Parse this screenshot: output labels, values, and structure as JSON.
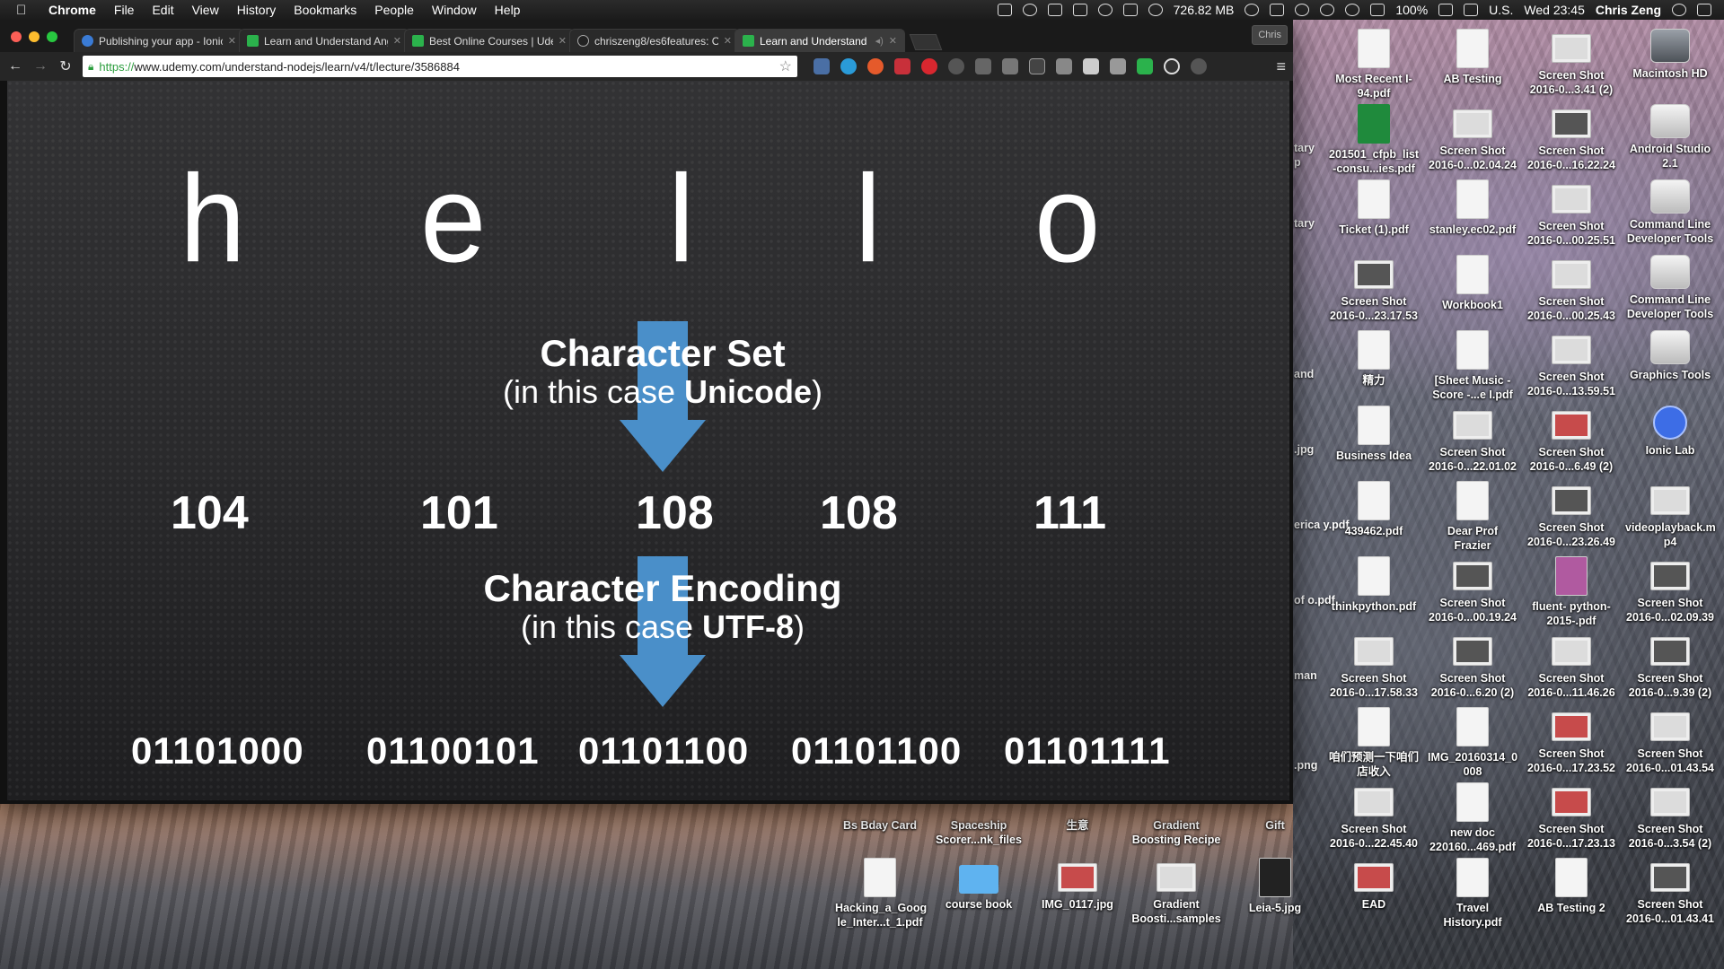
{
  "menubar": {
    "app": "Chrome",
    "menus": [
      "File",
      "Edit",
      "View",
      "History",
      "Bookmarks",
      "People",
      "Window",
      "Help"
    ],
    "memory": "726.82 MB",
    "battery": "100%",
    "input_source": "U.S.",
    "clock": "Wed 23:45",
    "user": "Chris Zeng"
  },
  "browser": {
    "profile": "Chris",
    "tabs": [
      {
        "title": "Publishing your app - Ionic",
        "favicon": "ionic",
        "active": false
      },
      {
        "title": "Learn and Understand Angular",
        "favicon": "udemy",
        "active": false
      },
      {
        "title": "Best Online Courses | Udemy",
        "favicon": "udemy",
        "active": false
      },
      {
        "title": "chriszeng8/es6features: O",
        "favicon": "github",
        "active": false
      },
      {
        "title": "Learn and Understand N",
        "favicon": "udemy",
        "active": true
      }
    ],
    "url_scheme": "https://",
    "url_rest": "www.udemy.com/understand-nodejs/learn/v4/t/lecture/3586884"
  },
  "slide": {
    "letters": [
      "h",
      "e",
      "l",
      "l",
      "o"
    ],
    "charset_title": "Character Set",
    "charset_sub_prefix": "(in this case ",
    "charset_sub_bold": "Unicode",
    "charset_sub_suffix": ")",
    "codes": [
      "104",
      "101",
      "108",
      "108",
      "111"
    ],
    "encoding_title": "Character Encoding",
    "encoding_sub_prefix": "(in this case ",
    "encoding_sub_bold": "UTF-8",
    "encoding_sub_suffix": ")",
    "binary": [
      "01101000",
      "01100101",
      "01101100",
      "01101100",
      "01101111"
    ],
    "arrow_color": "#4a8fc9"
  },
  "desktop": {
    "icons": {
      "c1": [
        "Most Recent I-94.pdf",
        "201501_cfpb_list -consu...ies.pdf",
        "Ticket (1).pdf",
        "Screen Shot 2016-0...23.17.53",
        "精力",
        "Business Idea",
        "439462.pdf",
        "thinkpython.pdf",
        "Screen Shot 2016-0...17.58.33",
        "咱们预测一下咱们店收入",
        "Screen Shot 2016-0...22.45.40",
        "EAD"
      ],
      "c2": [
        "AB Testing",
        "Screen Shot 2016-0...02.04.24",
        "stanley.ec02.pdf",
        "Workbook1",
        "[Sheet Music - Score -...e I.pdf",
        "Screen Shot 2016-0...22.01.02",
        "Dear Prof Frazier",
        "Screen Shot 2016-0...00.19.24",
        "Screen Shot 2016-0...6.20 (2)",
        "IMG_20160314_0 008",
        "new doc 220160...469.pdf",
        "Travel History.pdf"
      ],
      "c3": [
        "Screen Shot 2016-0...3.41 (2)",
        "Screen Shot 2016-0...16.22.24",
        "Screen Shot 2016-0...00.25.51",
        "Screen Shot 2016-0...00.25.43",
        "Screen Shot 2016-0...13.59.51",
        "Screen Shot 2016-0...6.49 (2)",
        "Screen Shot 2016-0...23.26.49",
        "fluent- python-2015-.pdf",
        "Screen Shot 2016-0...11.46.26",
        "Screen Shot 2016-0...17.23.52",
        "Screen Shot 2016-0...17.23.13",
        "AB Testing 2"
      ],
      "c4": [
        "Macintosh HD",
        "Android Studio 2.1",
        "Command Line Developer Tools",
        "Command Line Developer Tools",
        "Graphics Tools",
        "Ionic Lab",
        "videoplayback.m p4",
        "Screen Shot 2016-0...02.09.39",
        "Screen Shot 2016-0...9.39 (2)",
        "Screen Shot 2016-0...01.43.54",
        "Screen Shot 2016-0...3.54 (2)",
        "Screen Shot 2016-0...01.43.41"
      ],
      "bottom1": [
        "Bs Bday Card",
        "Spaceship Scorer...nk_files",
        "生意",
        "Gradient Boosting Recipe",
        "Gift"
      ],
      "bottom2": [
        "Hacking_a_Goog le_Inter...t_1.pdf",
        "course book",
        "IMG_0117.jpg",
        "Gradient Boosti...samples",
        "Leia-5.jpg"
      ],
      "cut": [
        "tary",
        "p",
        "tary",
        "and",
        ".jpg",
        "erica y.pdf",
        "of o.pdf",
        "man",
        ".png"
      ]
    }
  }
}
